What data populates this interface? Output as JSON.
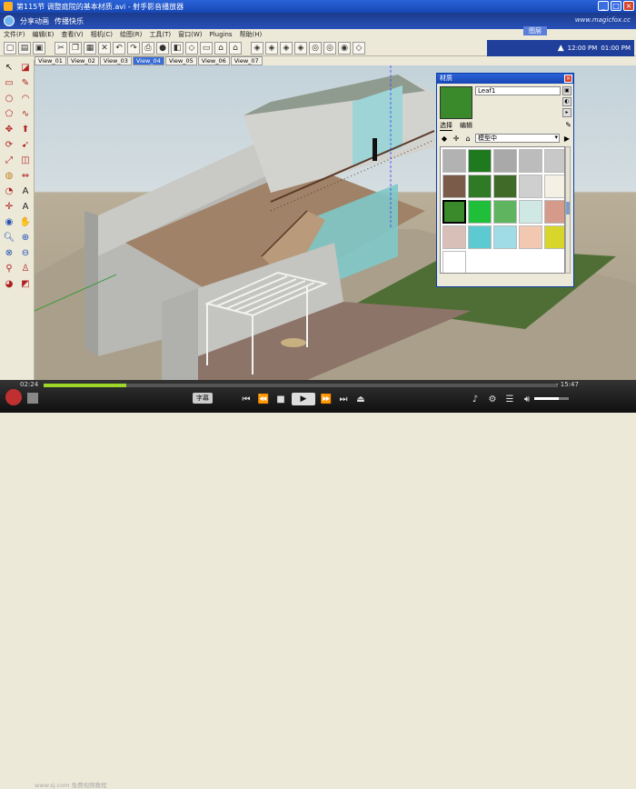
{
  "window": {
    "title": "第115节 调整庭院的基本材质.avi - 射手影音播放器"
  },
  "share_bar": {
    "items": [
      "分享动画",
      "传播快乐"
    ],
    "brand": "www.magicfox.cc"
  },
  "menubar": {
    "items": [
      "文件(F)",
      "编辑(E)",
      "查看(V)",
      "相机(C)",
      "绘图(R)",
      "工具(T)",
      "窗口(W)",
      "Plugins",
      "帮助(H)"
    ]
  },
  "clock": {
    "label": "图层",
    "time": "12:00 PM",
    "time2": "01:00 PM"
  },
  "view_tabs": [
    "View_01",
    "View_02",
    "View_03",
    "View_04",
    "View_05",
    "View_06",
    "View_07"
  ],
  "active_tab": "View_04",
  "material_panel": {
    "title": "材质",
    "material_name": "Leaf1",
    "tabs": [
      "选择",
      "编辑"
    ],
    "collection": "模型中",
    "swatches": [
      "#b2b2b2",
      "#1f7a1f",
      "#a9a9a9",
      "#bcbcbc",
      "#c8c8c8",
      "#7a5a48",
      "#2f7a24",
      "#3f6a28",
      "#cfcfcf",
      "#f4f1e4",
      "#3a8a2c",
      "#1fbf3a",
      "#5fb55f",
      "#cfe8e4",
      "#d69a8a",
      "#d8c0b8",
      "#5ccad0",
      "#9fdce6",
      "#f2c8b0",
      "#d8d62a",
      "#ffffff"
    ],
    "selected_index": 10,
    "colors": {
      "title_bar": "#1746b4",
      "selected_big": "#3a8a2c"
    }
  },
  "player": {
    "time_elapsed": "02:24",
    "time_remaining": "- 15:47",
    "progress": 0.16,
    "volume": 0.7,
    "subtitle_label": "字幕",
    "watermark": "www.sj.com 免费视频教程"
  }
}
